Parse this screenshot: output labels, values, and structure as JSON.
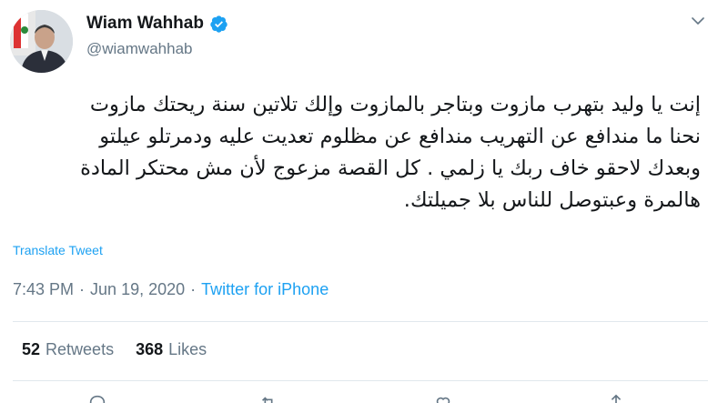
{
  "user": {
    "display_name": "Wiam Wahhab",
    "handle": "@wiamwahhab",
    "verified": true
  },
  "tweet": {
    "lines": [
      "إنت يا وليد بتهرب مازوت وبتاجر بالمازوت وإلك تلاتين سنة ريحتك مازوت",
      "نحنا ما مندافع عن التهريب مندافع عن مظلوم تعديت عليه ودمرتلو عيلتو",
      "وبعدك لاحقو خاف ربك يا زلمي . كل القصة مزعوج لأن مش محتكر المادة",
      "هالمرة وعبتوصل للناس بلا جميلتك."
    ],
    "translate_label": "Translate Tweet",
    "time": "7:43 PM",
    "date": "Jun 19, 2020",
    "separator": "·",
    "source": "Twitter for iPhone"
  },
  "stats": {
    "retweets_count": "52",
    "retweets_label": "Retweets",
    "likes_count": "368",
    "likes_label": "Likes"
  },
  "colors": {
    "accent": "#1da1f2",
    "secondary_text": "#657786",
    "primary_text": "#14171a",
    "divider": "#e1e8ed"
  },
  "icons": [
    "verified-badge-icon",
    "chevron-down-icon",
    "reply-icon",
    "retweet-icon",
    "like-icon",
    "share-icon"
  ]
}
